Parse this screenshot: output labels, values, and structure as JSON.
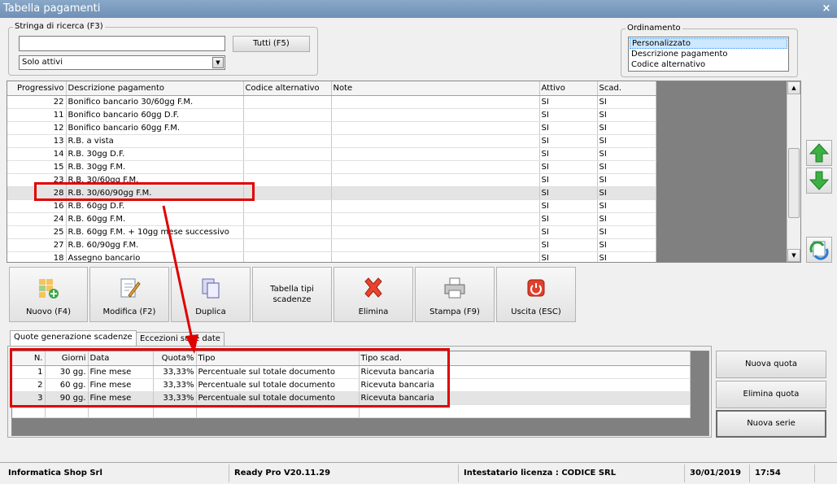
{
  "window": {
    "title": "Tabella pagamenti",
    "close_glyph": "×"
  },
  "search": {
    "group_label": "Stringa di ricerca (F3)",
    "input_value": "",
    "all_button": "Tutti (F5)",
    "filter_selected": "Solo attivi"
  },
  "ordering": {
    "group_label": "Ordinamento",
    "options": [
      "Personalizzato",
      "Descrizione pagamento",
      "Codice alternativo"
    ],
    "selected": "Personalizzato"
  },
  "grid": {
    "columns": [
      "Progressivo",
      "Descrizione pagamento",
      "Codice alternativo",
      "Note",
      "Attivo",
      "Scad."
    ],
    "rows": [
      [
        "22",
        "Bonifico bancario 30/60gg F.M.",
        "",
        "",
        "SI",
        "SI"
      ],
      [
        "11",
        "Bonifico bancario 60gg D.F.",
        "",
        "",
        "SI",
        "SI"
      ],
      [
        "12",
        "Bonifico bancario 60gg F.M.",
        "",
        "",
        "SI",
        "SI"
      ],
      [
        "13",
        "R.B. a vista",
        "",
        "",
        "SI",
        "SI"
      ],
      [
        "14",
        "R.B. 30gg D.F.",
        "",
        "",
        "SI",
        "SI"
      ],
      [
        "15",
        "R.B. 30gg F.M.",
        "",
        "",
        "SI",
        "SI"
      ],
      [
        "23",
        "R.B. 30/60gg F.M.",
        "",
        "",
        "SI",
        "SI"
      ],
      [
        "28",
        "R.B. 30/60/90gg F.M.",
        "",
        "",
        "SI",
        "SI"
      ],
      [
        "16",
        "R.B. 60gg D.F.",
        "",
        "",
        "SI",
        "SI"
      ],
      [
        "24",
        "R.B. 60gg F.M.",
        "",
        "",
        "SI",
        "SI"
      ],
      [
        "25",
        "R.B. 60gg F.M. + 10gg mese successivo",
        "",
        "",
        "SI",
        "SI"
      ],
      [
        "27",
        "R.B. 60/90gg F.M.",
        "",
        "",
        "SI",
        "SI"
      ],
      [
        "18",
        "Assegno bancario",
        "",
        "",
        "SI",
        "SI"
      ]
    ],
    "selected_index": 7
  },
  "toolbar": {
    "new": "Nuovo (F4)",
    "edit": "Modifica (F2)",
    "duplicate": "Duplica",
    "deadline_types": "Tabella tipi scadenze",
    "delete": "Elimina",
    "print": "Stampa (F9)",
    "exit": "Uscita (ESC)"
  },
  "tabs": {
    "quotas": "Quote generazione scadenze",
    "exceptions": "Eccezioni sulle date"
  },
  "quotas": {
    "columns": [
      "N.",
      "Giorni",
      "Data",
      "Quota%",
      "Tipo",
      "Tipo scad."
    ],
    "rows": [
      [
        "1",
        "30 gg.",
        "Fine mese",
        "33,33%",
        "Percentuale sul totale documento",
        "Ricevuta bancaria"
      ],
      [
        "2",
        "60 gg.",
        "Fine mese",
        "33,33%",
        "Percentuale sul totale documento",
        "Ricevuta bancaria"
      ],
      [
        "3",
        "90 gg.",
        "Fine mese",
        "33,33%",
        "Percentuale sul totale documento",
        "Ricevuta bancaria"
      ]
    ]
  },
  "side_buttons": {
    "new_quota": "Nuova quota",
    "delete_quota": "Elimina quota",
    "new_series": "Nuova serie"
  },
  "status": {
    "company": "Informatica Shop Srl",
    "version": "Ready Pro V20.11.29",
    "license": "Intestatario licenza : CODICE SRL",
    "date": "30/01/2019",
    "time": "17:54"
  },
  "colors": {
    "title_bar": "#7896bb",
    "highlight_red": "#e00000",
    "selection": "#cde8ff"
  }
}
